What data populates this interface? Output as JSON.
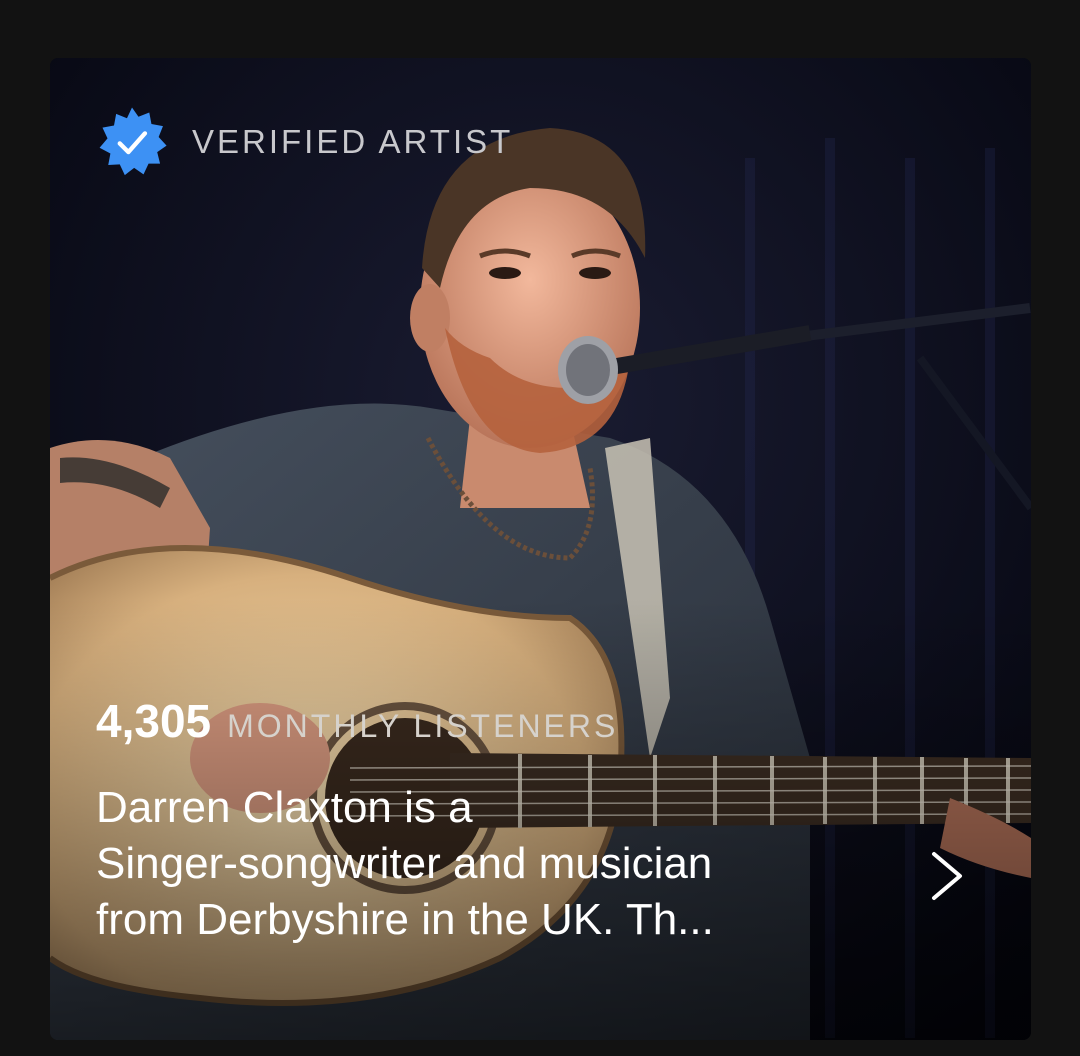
{
  "artist_card": {
    "badge_label": "VERIFIED ARTIST",
    "badge_icon": "verified-badge-icon",
    "badge_color": "#3d91f4",
    "listeners_count": "4,305",
    "listeners_label": "MONTHLY LISTENERS",
    "bio_lines": [
      "Darren Claxton is a",
      "Singer-songwriter and musician",
      "from Derbyshire in the UK. Th..."
    ],
    "chevron_icon": "chevron-right-icon"
  }
}
